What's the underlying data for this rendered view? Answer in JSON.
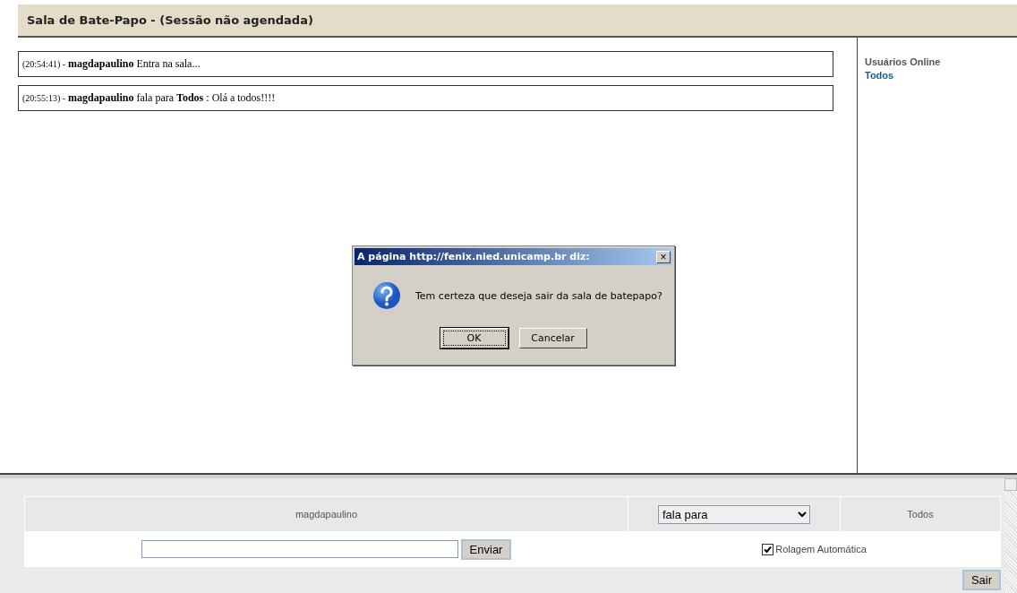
{
  "header": {
    "title": "Sala de Bate-Papo - (Sessão não agendada)"
  },
  "messages": [
    {
      "time": "(20:54:41) -",
      "text": "**magdapaulino** Entra na sala..."
    },
    {
      "time": "(20:55:13) -",
      "text": "**magdapaulino** fala para **Todos** : Olá a todos!!!!"
    }
  ],
  "online": {
    "title": "Usuários Online",
    "users": [
      "Todos"
    ]
  },
  "dialog": {
    "title": "A página http://fenix.nied.unicamp.br diz:",
    "close": "×",
    "message": "Tem certeza que deseja sair da sala de batepapo?",
    "buttons": [
      {
        "label": "OK",
        "selected": true
      },
      {
        "label": "Cancelar",
        "selected": false
      }
    ]
  },
  "compose": {
    "user": "magdapaulino",
    "mode": "fala para",
    "recipient": "Todos",
    "send": "Enviar",
    "autoscroll": {
      "label": "Rolagem Automática",
      "checked": true
    },
    "exit": "Sair"
  }
}
